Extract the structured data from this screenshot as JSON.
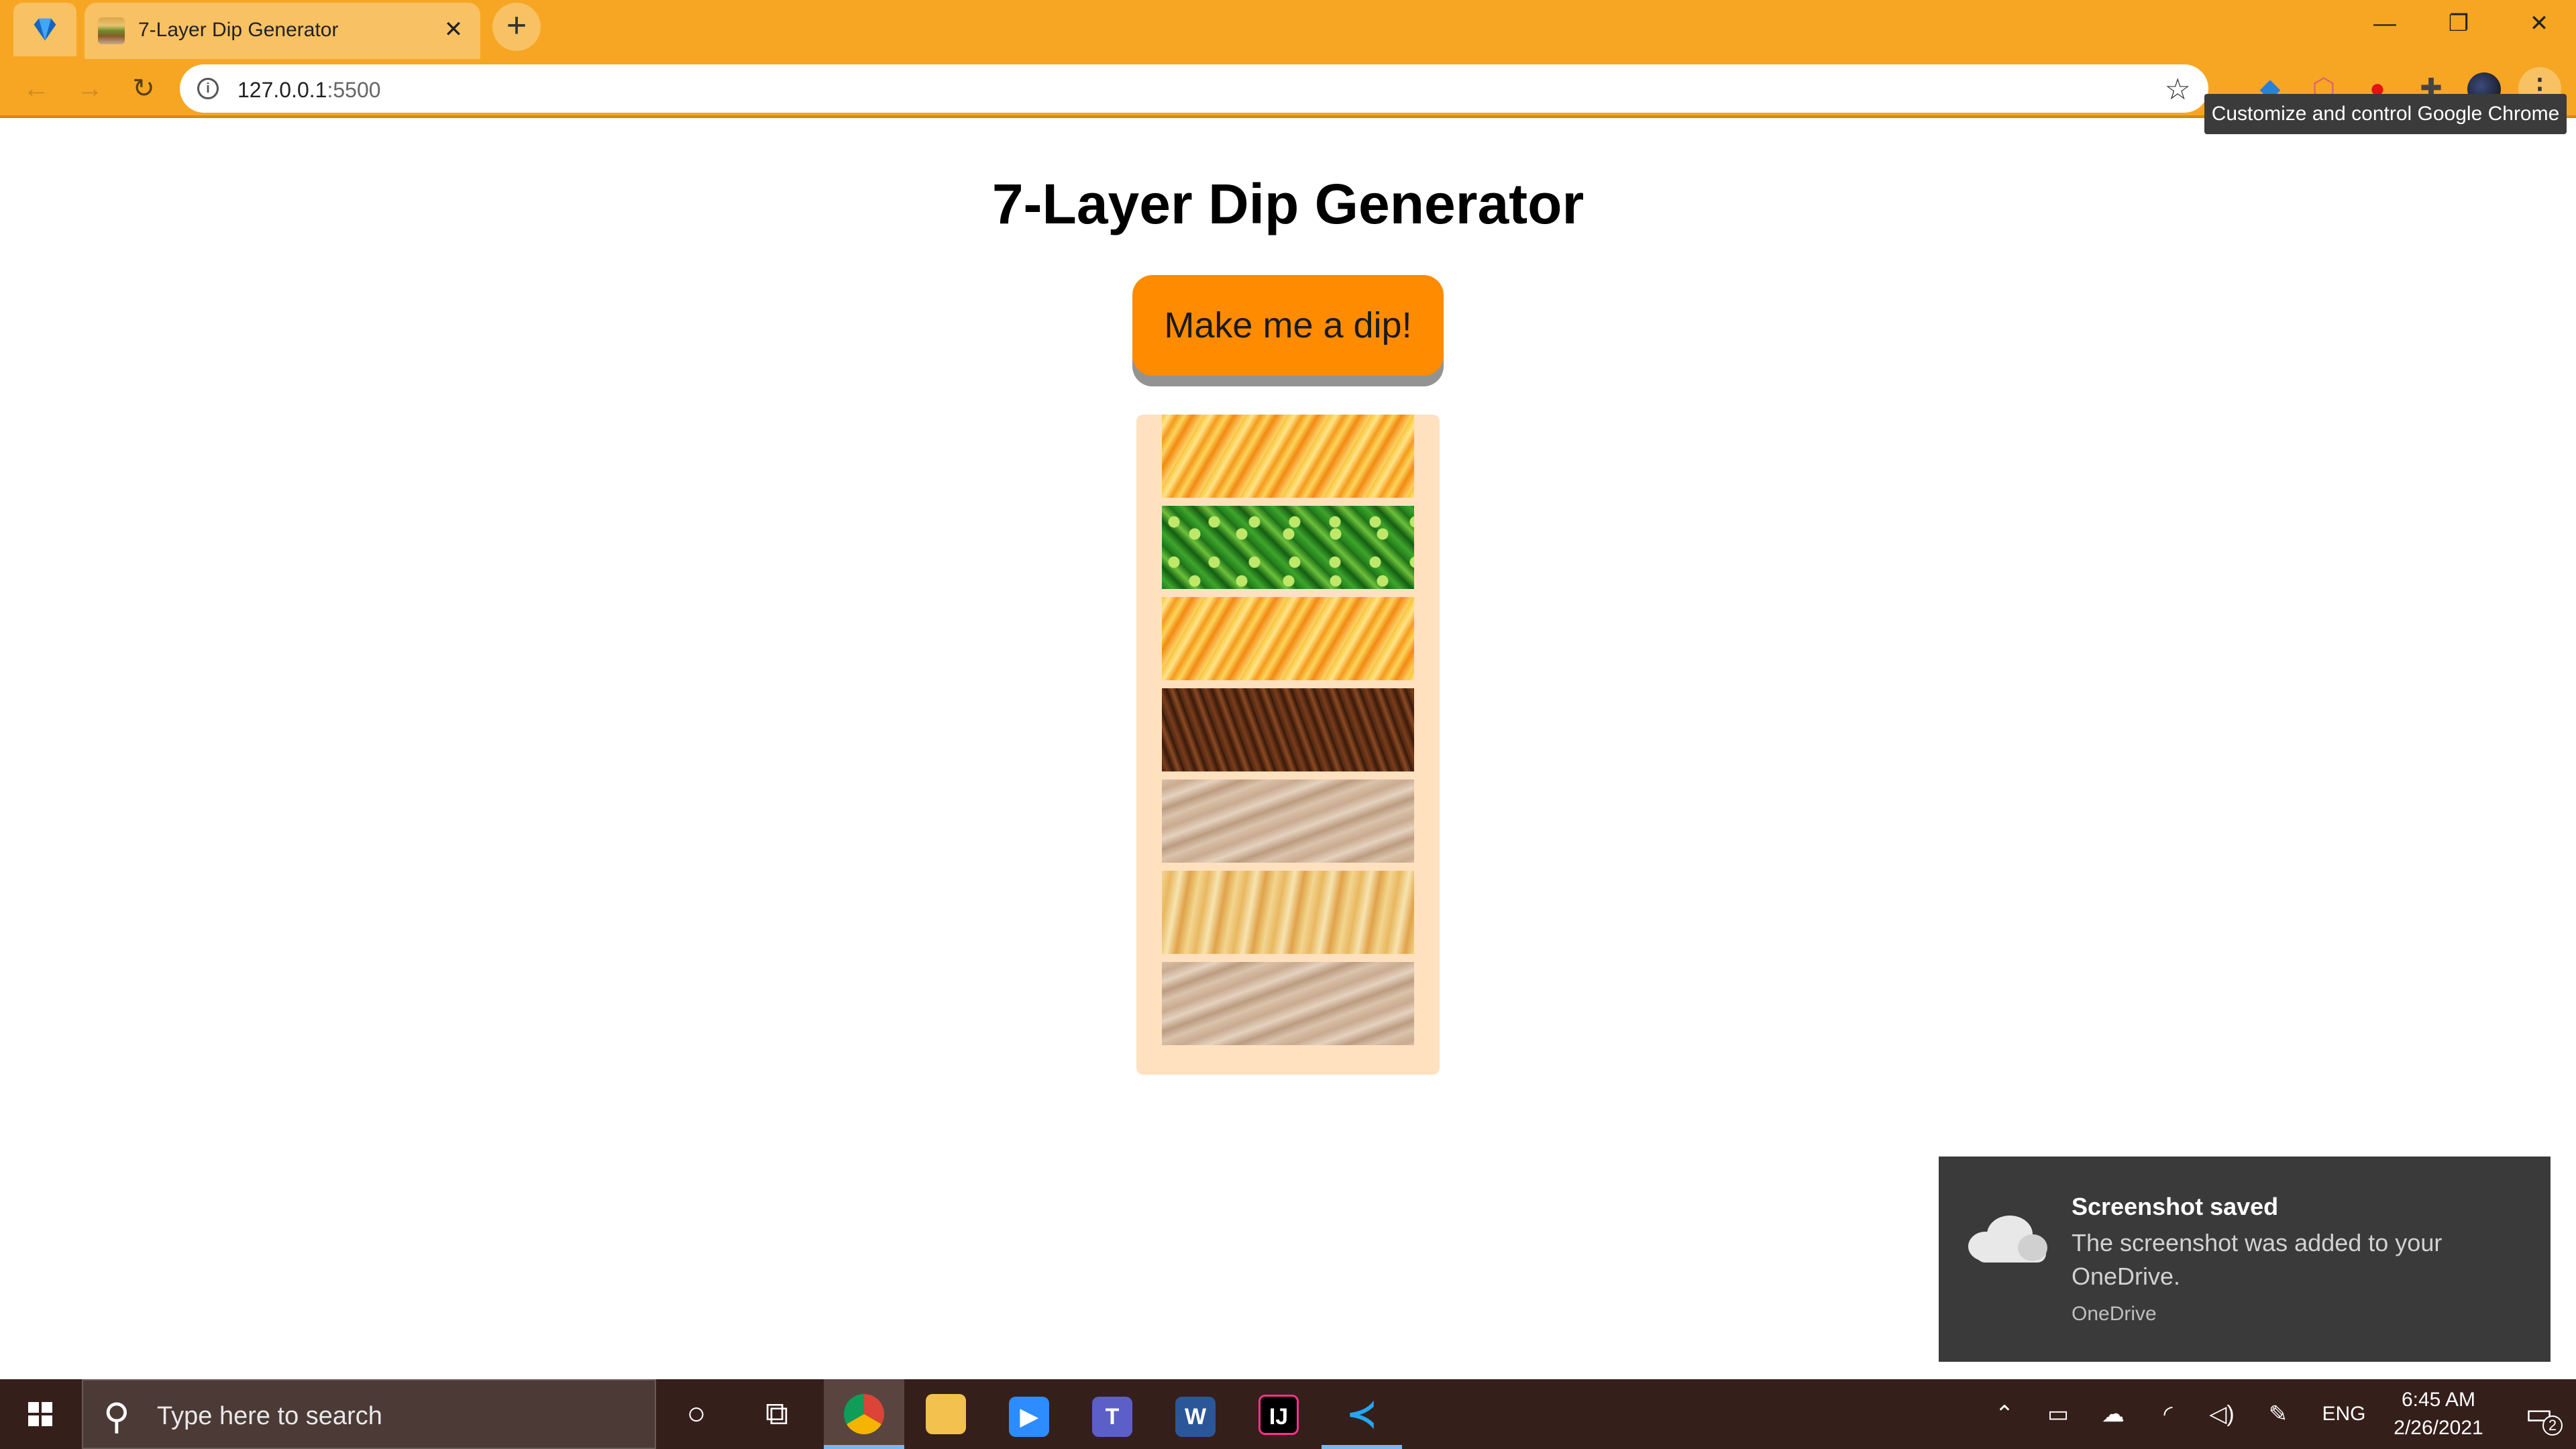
{
  "browser": {
    "tab": {
      "title": "7-Layer Dip Generator"
    },
    "address": {
      "host": "127.0.0.1",
      "port": ":5500"
    },
    "tooltip": "Customize and control Google Chrome",
    "colors": {
      "frame": "#f6a623"
    }
  },
  "page": {
    "title": "7-Layer Dip Generator",
    "button_label": "Make me a dip!",
    "layers": [
      {
        "name": "shredded-cheese"
      },
      {
        "name": "jalapenos"
      },
      {
        "name": "shredded-cheese"
      },
      {
        "name": "ground-beef"
      },
      {
        "name": "refried-beans"
      },
      {
        "name": "sour-cream"
      },
      {
        "name": "refried-beans"
      }
    ],
    "colors": {
      "button": "#ff8b00",
      "container": "#ffe1c0"
    }
  },
  "toast": {
    "title": "Screenshot saved",
    "body": "The screenshot was added to your OneDrive.",
    "source": "OneDrive",
    "icon": "cloud-icon"
  },
  "taskbar": {
    "search_placeholder": "Type here to search",
    "apps": [
      "chrome",
      "file-explorer",
      "zoom",
      "teams",
      "word",
      "intellij",
      "vscode"
    ],
    "tray": {
      "language": "ENG",
      "time": "6:45 AM",
      "date": "2/26/2021",
      "notifications": "2"
    }
  }
}
